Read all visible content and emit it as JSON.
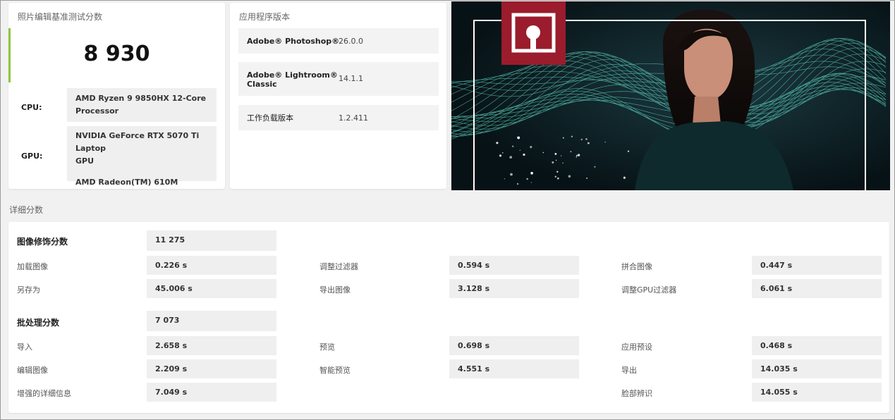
{
  "score_card": {
    "title": "照片编辑基准测试分数",
    "score": "8 930",
    "cpu_label": "CPU:",
    "cpu_value_line1": "AMD Ryzen 9 9850HX 12-Core",
    "cpu_value_line2": "Processor",
    "gpu_label": "GPU:",
    "gpu_value_line1": "NVIDIA GeForce RTX 5070 Ti Laptop",
    "gpu_value_line2": "GPU",
    "gpu_value_line3": "AMD Radeon(TM) 610M"
  },
  "versions": {
    "title": "应用程序版本",
    "rows": [
      {
        "name_line1": "Adobe® Photoshop®",
        "name_line2": "",
        "value": "26.0.0"
      },
      {
        "name_line1": "Adobe® Lightroom®",
        "name_line2": "Classic",
        "value": "14.1.1"
      },
      {
        "name_line1": "工作负载版本",
        "name_line2": "",
        "value": "1.2.411"
      }
    ]
  },
  "banner": {
    "logo_icon": "image-frame-icon",
    "colors": {
      "logo_bg": "#9b1c2c",
      "wave": "#5fd6c2",
      "accent": "#8cc63f"
    }
  },
  "details": {
    "title": "详细分数",
    "image_retouch": {
      "label": "图像修饰分数",
      "score": "11 275",
      "items": [
        {
          "label": "加载图像",
          "value": "0.226 s"
        },
        {
          "label": "调整过滤器",
          "value": "0.594 s"
        },
        {
          "label": "拼合图像",
          "value": "0.447 s"
        },
        {
          "label": "另存为",
          "value": "45.006 s"
        },
        {
          "label": "导出图像",
          "value": "3.128 s"
        },
        {
          "label": "调整GPU过滤器",
          "value": "6.061 s"
        }
      ]
    },
    "batch": {
      "label": "批处理分数",
      "score": "7 073",
      "items": [
        {
          "label": "导入",
          "value": "2.658 s"
        },
        {
          "label": "预览",
          "value": "0.698 s"
        },
        {
          "label": "应用预设",
          "value": "0.468 s"
        },
        {
          "label": "编辑图像",
          "value": "2.209 s"
        },
        {
          "label": "智能预览",
          "value": "4.551 s"
        },
        {
          "label": "导出",
          "value": "14.035 s"
        },
        {
          "label": "增强的详细信息",
          "value": "7.049 s"
        },
        {
          "label": "脸部辨识",
          "value": "14.055 s"
        }
      ]
    }
  }
}
